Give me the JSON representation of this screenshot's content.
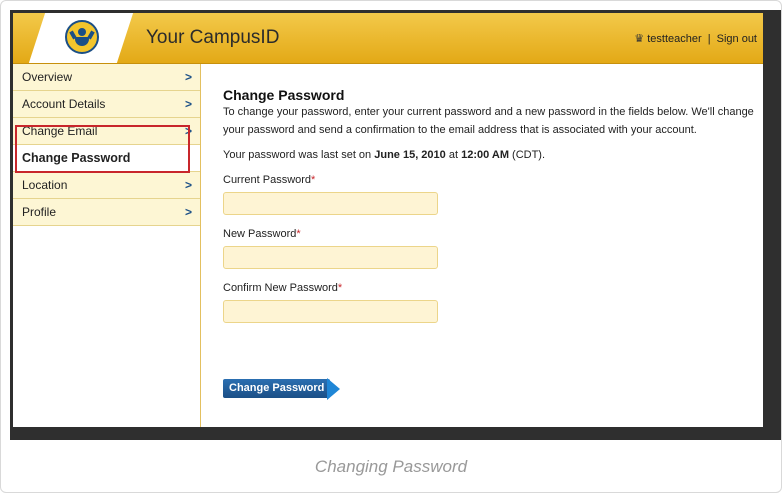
{
  "header": {
    "app_title": "Your CampusID",
    "user_name": "testteacher",
    "separator": "|",
    "sign_out": "Sign out",
    "user_icon": "crown-icon"
  },
  "sidebar": {
    "items": [
      {
        "label": "Overview",
        "chevron": ">"
      },
      {
        "label": "Account Details",
        "chevron": ">"
      },
      {
        "label": "Change Email",
        "chevron": ">"
      },
      {
        "label": "Change Password",
        "chevron": ""
      },
      {
        "label": "Location",
        "chevron": ">"
      },
      {
        "label": "Profile",
        "chevron": ">"
      }
    ],
    "active_item": "Change Password"
  },
  "content": {
    "title": "Change Password",
    "intro": "To change your password, enter your current password and a new password in the fields below. We'll change your password and send a confirmation to the email address that is associated with your account.",
    "last_set_prefix": "Your password was last set on ",
    "last_set_date": "June 15, 2010",
    "last_set_at": " at ",
    "last_set_time": "12:00 AM",
    "last_set_suffix": " (CDT).",
    "fields": [
      {
        "label": "Current Password",
        "required_mark": "*",
        "value": ""
      },
      {
        "label": "New Password",
        "required_mark": "*",
        "value": ""
      },
      {
        "label": "Confirm New Password",
        "required_mark": "*",
        "value": ""
      }
    ],
    "submit_label": "Change Password"
  },
  "caption": "Changing Password",
  "colors": {
    "header_gold": "#e3a916",
    "brand_blue": "#1b4f86",
    "highlight_red": "#c8262b",
    "field_bg": "#fef4d4"
  }
}
